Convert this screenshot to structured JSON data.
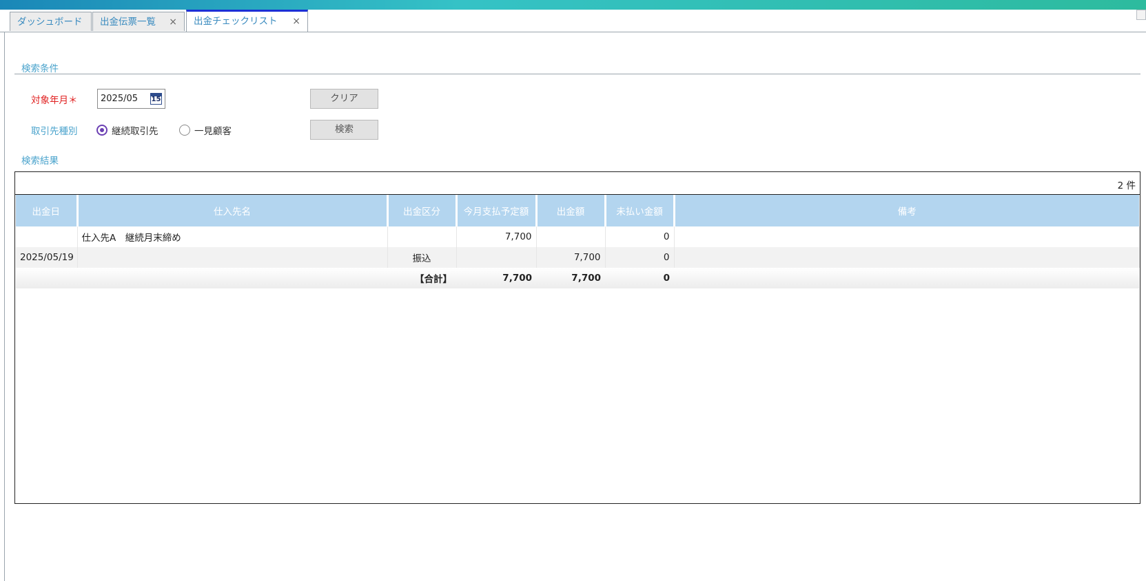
{
  "tabs": [
    {
      "label": "ダッシュボード",
      "closable": false,
      "active": false
    },
    {
      "label": "出金伝票一覧",
      "closable": true,
      "active": false
    },
    {
      "label": "出金チェックリスト",
      "closable": true,
      "active": true
    }
  ],
  "close_glyph": "×",
  "search": {
    "section_title": "検索条件",
    "target_month_label": "対象年月＊",
    "target_month_value": "2025/05",
    "calendar_day": "15",
    "partner_type_label": "取引先種別",
    "partner_type_options": [
      {
        "label": "継続取引先",
        "selected": true
      },
      {
        "label": "一見顧客",
        "selected": false
      }
    ],
    "clear_button": "クリア",
    "search_button": "検索"
  },
  "results": {
    "section_title": "検索結果",
    "count": "2 件",
    "columns": [
      "出金日",
      "仕入先名",
      "出金区分",
      "今月支払予定額",
      "出金額",
      "未払い金額",
      "備考"
    ],
    "rows": [
      [
        "",
        "仕入先A　継続月末締め",
        "",
        "7,700",
        "",
        "0",
        ""
      ],
      [
        "2025/05/19",
        "",
        "振込",
        "",
        "7,700",
        "0",
        ""
      ]
    ],
    "total": {
      "label": "【合計】",
      "scheduled": "7,700",
      "paid": "7,700",
      "unpaid": "0"
    }
  },
  "colors": {
    "accent": "#4aa3cc",
    "header_bg": "#b3d5ef",
    "required": "#e02020",
    "radio": "#6b3fb3"
  }
}
